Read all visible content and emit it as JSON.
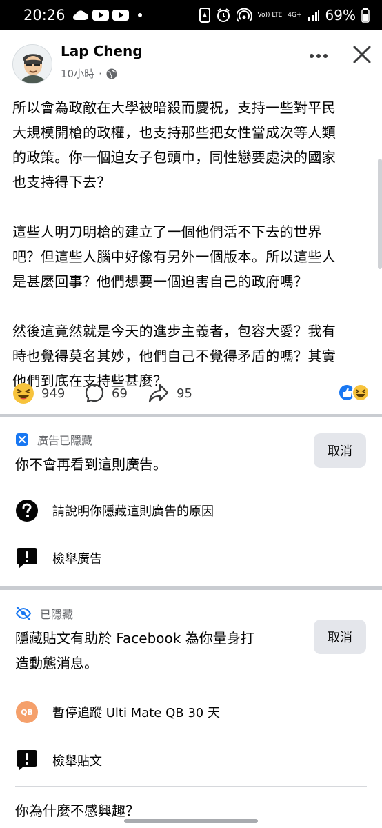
{
  "status_bar": {
    "time": "20:26",
    "network_label": "Vo)) LTE",
    "signal_label": "4G+",
    "battery": "69%"
  },
  "post": {
    "author": "Lap Cheng",
    "time": "10小時",
    "meta_sep": "·",
    "text": "所以會為政敵在大學被暗殺而慶祝，支持一些對平民\n大規模開槍的政權，也支持那些把女性當成次等人類\n的政策。你一個迫女子包頭巾，同性戀要處決的國家\n也支持得下去？\n\n這些人明刀明槍的建立了一個他們活不下去的世界\n吧？但這些人腦中好像有另外一個版本。所以這些人\n是甚麼回事？他們想要一個迫害自己的政府嗎？\n\n然後這竟然就是今天的進步主義者，包容大愛？我有\n時也覺得莫名其妙，他們自己不覺得矛盾的嗎？其實\n他們到底在支持些甚麼？",
    "reactions_count": "949",
    "comments_count": "69",
    "shares_count": "95"
  },
  "hidden_ad": {
    "tag": "廣告已隱藏",
    "message": "你不會再看到這則廣告。",
    "undo_label": "取消",
    "reason_label": "請說明你隱藏這則廣告的原因",
    "report_label": "檢舉廣告"
  },
  "hidden_post": {
    "tag": "已隱藏",
    "message": "隱藏貼文有助於 Facebook 為你量身打\n造動態消息。",
    "undo_label": "取消",
    "snooze_badge": "QB",
    "snooze_label": "暫停追蹤 Ulti Mate QB 30 天",
    "report_label": "檢舉貼文",
    "why_label": "你為什麼不感興趣？"
  },
  "colors": {
    "accent_blue": "#1877f2",
    "snooze_orange": "#f5a06b",
    "button_bg": "#e4e6eb"
  }
}
